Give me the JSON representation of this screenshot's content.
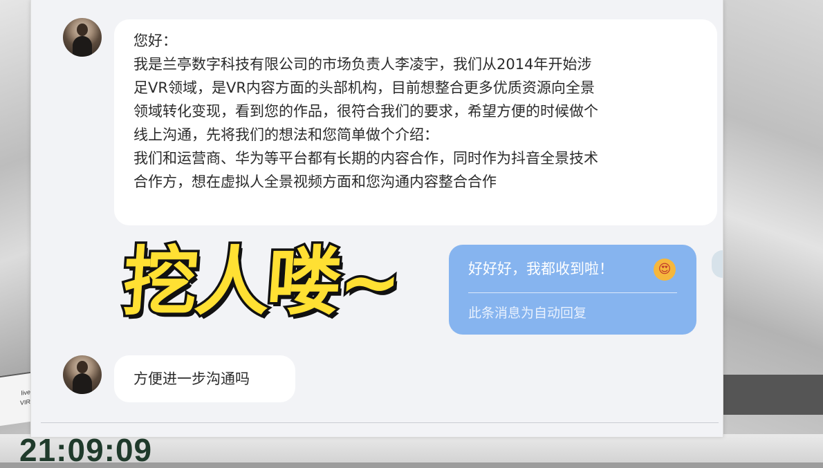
{
  "background": {
    "clock": "21:09:09",
    "side_text": [
      "live",
      "VIR"
    ]
  },
  "chat": {
    "messages": [
      {
        "sender": "contact",
        "lines": [
          "您好：",
          "我是兰亭数字科技有限公司的市场负责人李凌宇，我们从2014年开始涉",
          "足VR领域，是VR内容方面的头部机构，目前想整合更多优质资源向全景",
          "领域转化变现，看到您的作品，很符合我们的要求，希望方便的时候做个",
          "线上沟通，先将我们的想法和您简单做个介绍：",
          "我们和运营商、华为等平台都有长期的内容合作，同时作为抖音全景技术",
          "合作方，想在虚拟人全景视频方面和您沟通内容整合合作"
        ]
      },
      {
        "sender": "self",
        "text": "好好好，我都收到啦！",
        "emoji": "😍",
        "footnote": "此条消息为自动回复"
      },
      {
        "sender": "contact",
        "lines": [
          "方便进一步沟通吗"
        ]
      }
    ]
  },
  "overlay": {
    "caption": "挖人喽~",
    "caption_color": "#ffe033"
  },
  "colors": {
    "self_bubble": "#86b4ef",
    "contact_bubble": "#ffffff",
    "chat_background": "#f2f3f6"
  }
}
